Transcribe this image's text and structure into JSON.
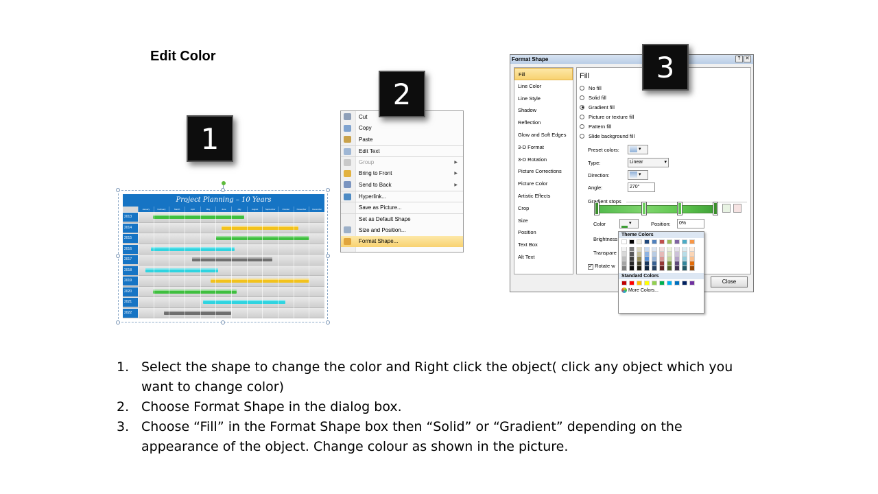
{
  "title": "Edit Color",
  "badges": [
    "1",
    "2",
    "3"
  ],
  "gantt": {
    "title": "Project Planning – 10 Years",
    "months": [
      "January",
      "February",
      "March",
      "April",
      "May",
      "June",
      "July",
      "August",
      "September",
      "October",
      "November",
      "December"
    ],
    "rows": [
      {
        "year": "2013",
        "start": 0.08,
        "end": 0.57,
        "color": "#3fbf3f"
      },
      {
        "year": "2014",
        "start": 0.45,
        "end": 0.86,
        "color": "#f2c21d"
      },
      {
        "year": "2015",
        "start": 0.42,
        "end": 0.92,
        "color": "#3fbf3f"
      },
      {
        "year": "2016",
        "start": 0.07,
        "end": 0.52,
        "color": "#2fd4e0"
      },
      {
        "year": "2017",
        "start": 0.29,
        "end": 0.72,
        "color": "#6f6f6f"
      },
      {
        "year": "2018",
        "start": 0.04,
        "end": 0.43,
        "color": "#2fd4e0"
      },
      {
        "year": "2019",
        "start": 0.39,
        "end": 0.92,
        "color": "#f2c21d"
      },
      {
        "year": "2020",
        "start": 0.08,
        "end": 0.53,
        "color": "#3fbf3f"
      },
      {
        "year": "2021",
        "start": 0.35,
        "end": 0.79,
        "color": "#2fd4e0"
      },
      {
        "year": "2022",
        "start": 0.14,
        "end": 0.5,
        "color": "#6f6f6f"
      }
    ]
  },
  "context_menu": {
    "items": [
      {
        "label": "Cut",
        "icon": "scissors-icon",
        "disabled": false,
        "submenu": false,
        "sep": false,
        "highlight": false,
        "iconColor": "#8e9fb8"
      },
      {
        "label": "Copy",
        "icon": "copy-icon",
        "disabled": false,
        "submenu": false,
        "sep": false,
        "highlight": false,
        "iconColor": "#7fa3cf"
      },
      {
        "label": "Paste",
        "icon": "paste-icon",
        "disabled": false,
        "submenu": false,
        "sep": false,
        "highlight": false,
        "iconColor": "#c9a24b"
      },
      {
        "label": "Edit Text",
        "icon": "edit-text-icon",
        "disabled": false,
        "submenu": false,
        "sep": true,
        "highlight": false,
        "iconColor": "#9fb7d5"
      },
      {
        "label": "Group",
        "icon": "group-icon",
        "disabled": true,
        "submenu": true,
        "sep": true,
        "highlight": false,
        "iconColor": "#c9c9c9"
      },
      {
        "label": "Bring to Front",
        "icon": "bring-front-icon",
        "disabled": false,
        "submenu": true,
        "sep": false,
        "highlight": false,
        "iconColor": "#e2b23f"
      },
      {
        "label": "Send to Back",
        "icon": "send-back-icon",
        "disabled": false,
        "submenu": true,
        "sep": false,
        "highlight": false,
        "iconColor": "#7b95c0"
      },
      {
        "label": "Hyperlink...",
        "icon": "hyperlink-icon",
        "disabled": false,
        "submenu": false,
        "sep": true,
        "highlight": false,
        "iconColor": "#4e8bc4"
      },
      {
        "label": "Save as Picture...",
        "icon": "",
        "disabled": false,
        "submenu": false,
        "sep": true,
        "highlight": false,
        "iconColor": ""
      },
      {
        "label": "Set as Default Shape",
        "icon": "",
        "disabled": false,
        "submenu": false,
        "sep": true,
        "highlight": false,
        "iconColor": ""
      },
      {
        "label": "Size and Position...",
        "icon": "size-position-icon",
        "disabled": false,
        "submenu": false,
        "sep": false,
        "highlight": false,
        "iconColor": "#9cb0c8"
      },
      {
        "label": "Format Shape...",
        "icon": "format-shape-icon",
        "disabled": false,
        "submenu": false,
        "sep": false,
        "highlight": true,
        "iconColor": "#e0a43c"
      }
    ]
  },
  "dialog": {
    "title": "Format Shape",
    "ctrl_help": "?",
    "ctrl_close": "✕",
    "categories": [
      "Fill",
      "Line Color",
      "Line Style",
      "Shadow",
      "Reflection",
      "Glow and Soft Edges",
      "3-D Format",
      "3-D Rotation",
      "Picture Corrections",
      "Picture Color",
      "Artistic Effects",
      "Crop",
      "Size",
      "Position",
      "Text Box",
      "Alt Text"
    ],
    "selected_category": "Fill",
    "section_title": "Fill",
    "options": [
      {
        "label": "No fill",
        "checked": false
      },
      {
        "label": "Solid fill",
        "checked": false
      },
      {
        "label": "Gradient fill",
        "checked": true
      },
      {
        "label": "Picture or texture fill",
        "checked": false
      },
      {
        "label": "Pattern fill",
        "checked": false
      },
      {
        "label": "Slide background fill",
        "checked": false
      }
    ],
    "preset_label": "Preset colors:",
    "type_label": "Type:",
    "type_value": "Linear",
    "direction_label": "Direction:",
    "angle_label": "Angle:",
    "angle_value": "270°",
    "stops_label": "Gradient stops",
    "color_label": "Color",
    "position_label": "Position:",
    "position_value": "0%",
    "brightness_label": "Brightness",
    "transparency_label": "Transpare",
    "rotate_label": "Rotate w",
    "close_label": "Close"
  },
  "picker": {
    "theme_label": "Theme Colors",
    "standard_label": "Standard Colors",
    "more_label": "More Colors...",
    "theme_top": [
      "#ffffff",
      "#000000",
      "#eeece1",
      "#1f497d",
      "#4f81bd",
      "#c0504d",
      "#9bbb59",
      "#8064a2",
      "#4bacc6",
      "#f79646"
    ],
    "theme_shades": [
      [
        "#f2f2f2",
        "#d8d8d8",
        "#bfbfbf",
        "#a5a5a5",
        "#7f7f7f"
      ],
      [
        "#7f7f7f",
        "#595959",
        "#3f3f3f",
        "#262626",
        "#0c0c0c"
      ],
      [
        "#ddd9c3",
        "#c4bd97",
        "#938953",
        "#494429",
        "#1d1b10"
      ],
      [
        "#c6d9f0",
        "#8db3e2",
        "#548dd4",
        "#17365d",
        "#0f243e"
      ],
      [
        "#dbe5f1",
        "#b8cce4",
        "#95b3d7",
        "#366092",
        "#244061"
      ],
      [
        "#f2dcdb",
        "#e5b9b7",
        "#d99694",
        "#953734",
        "#632423"
      ],
      [
        "#ebf1dd",
        "#d7e3bc",
        "#c3d69b",
        "#76923c",
        "#4f6128"
      ],
      [
        "#e5e0ec",
        "#ccc1d9",
        "#b2a2c7",
        "#5f497a",
        "#3f3151"
      ],
      [
        "#dbeef3",
        "#b7dde8",
        "#92cddc",
        "#31859b",
        "#205867"
      ],
      [
        "#fdeada",
        "#fbd5b5",
        "#fac08f",
        "#e36c09",
        "#974806"
      ]
    ],
    "standard": [
      "#c00000",
      "#ff0000",
      "#ffc000",
      "#ffff00",
      "#92d050",
      "#00b050",
      "#00b0f0",
      "#0070c0",
      "#002060",
      "#7030a0"
    ]
  },
  "steps": [
    {
      "num": "1.",
      "text": "Select the shape to change the color and Right click the object( click any object which you want to change color)"
    },
    {
      "num": "2.",
      "text": "Choose Format Shape in the dialog box."
    },
    {
      "num": "3.",
      "text": "Choose “Fill” in the Format Shape box then “Solid” or “Gradient” depending on the appearance of the object. Change colour as shown in the picture."
    }
  ]
}
